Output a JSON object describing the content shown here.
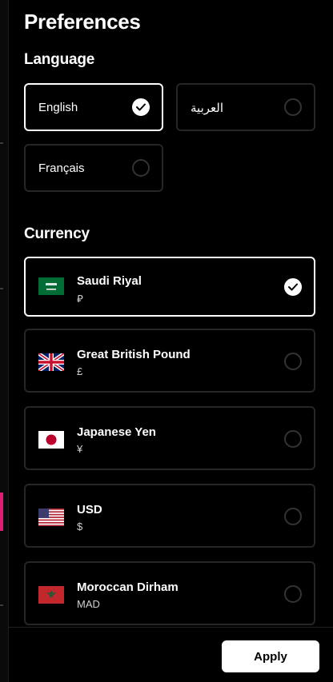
{
  "title": "Preferences",
  "language": {
    "label": "Language",
    "options": [
      {
        "label": "English",
        "selected": true
      },
      {
        "label": "العربية",
        "selected": false
      },
      {
        "label": "Français",
        "selected": false
      }
    ]
  },
  "currency": {
    "label": "Currency",
    "options": [
      {
        "name": "Saudi Riyal",
        "symbol": "⃁",
        "flag": "saudi-arabia-flag",
        "selected": true
      },
      {
        "name": "Great British Pound",
        "symbol": "£",
        "flag": "uk-flag",
        "selected": false
      },
      {
        "name": "Japanese Yen",
        "symbol": "¥",
        "flag": "japan-flag",
        "selected": false
      },
      {
        "name": "USD",
        "symbol": "$",
        "flag": "us-flag",
        "selected": false
      },
      {
        "name": "Moroccan Dirham",
        "symbol": "MAD",
        "flag": "morocco-flag",
        "selected": false
      }
    ]
  },
  "footer": {
    "apply_label": "Apply"
  },
  "colors": {
    "background": "#000000",
    "selected_border": "#ffffff",
    "unselected_border": "#262626",
    "accent_strip": "#e11d74"
  }
}
